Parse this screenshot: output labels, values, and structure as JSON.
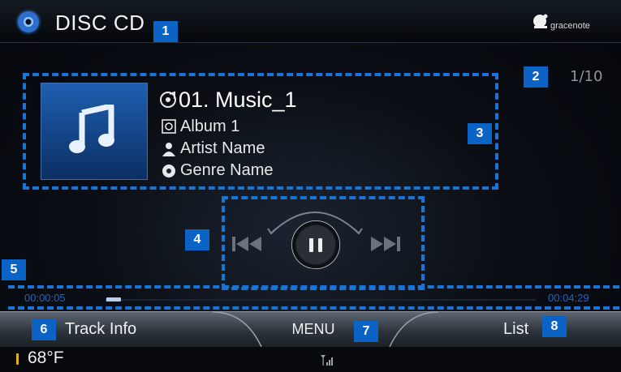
{
  "header": {
    "title": "DISC CD",
    "logo_text": "gracenote"
  },
  "track_counter": "1/10",
  "track": {
    "title": "01. Music_1",
    "album": "Album 1",
    "artist": "Artist Name",
    "genre": "Genre Name"
  },
  "playback": {
    "elapsed": "00:00:05",
    "total": "00:04:29",
    "progress_fraction": 0.019
  },
  "menu": {
    "track_info": "Track Info",
    "menu": "MENU",
    "list": "List"
  },
  "status": {
    "temperature": "68°F"
  },
  "markers": [
    "1",
    "2",
    "3",
    "4",
    "5",
    "6",
    "7",
    "8"
  ],
  "colors": {
    "marker_bg": "#0b63c6",
    "dashed_outline": "#1a73d6",
    "album_art": "#1f5fb0",
    "time_text": "#1f63c6"
  },
  "icons": {
    "disc": "disc-icon",
    "gracenote": "gracenote-logo-icon",
    "music_note": "music-note-icon",
    "track": "track-icon",
    "album": "album-icon",
    "artist": "artist-icon",
    "genre": "genre-icon",
    "prev": "skip-previous-icon",
    "pause": "pause-icon",
    "next": "skip-next-icon",
    "temperature": "thermometer-icon",
    "signal": "signal-icon"
  }
}
